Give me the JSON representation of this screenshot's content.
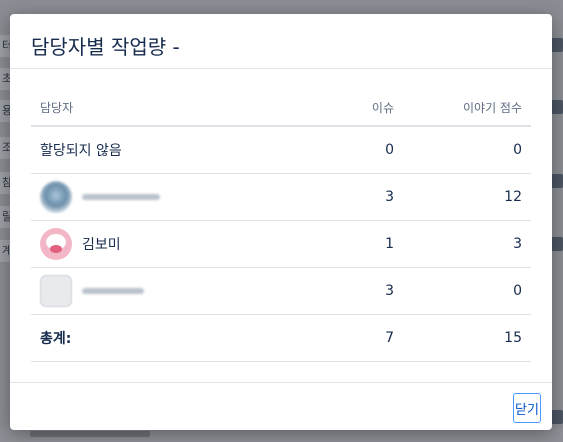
{
  "background": {
    "strips": [
      "터",
      "초",
      "용",
      "조",
      "참",
      "릴",
      "계"
    ]
  },
  "dialog": {
    "title": "담당자별 작업량 -",
    "columns": {
      "assignee": "담당자",
      "issues": "이슈",
      "story_points": "이야기 점수"
    },
    "rows": [
      {
        "name": "할당되지 않음",
        "issues": "0",
        "points": "0",
        "avatar": "none"
      },
      {
        "name": "",
        "issues": "3",
        "points": "12",
        "avatar": "blurred-avatar"
      },
      {
        "name": "김보미",
        "issues": "1",
        "points": "3",
        "avatar": "pink-character-avatar"
      },
      {
        "name": "",
        "issues": "3",
        "points": "0",
        "avatar": "blurred-avatar"
      }
    ],
    "total": {
      "label": "총계:",
      "issues": "7",
      "points": "15"
    },
    "close_label": "닫기"
  },
  "colors": {
    "accent": "#0052cc",
    "focus_border": "#4c9aff",
    "text": "#172b4d",
    "muted": "#5e6c84"
  }
}
